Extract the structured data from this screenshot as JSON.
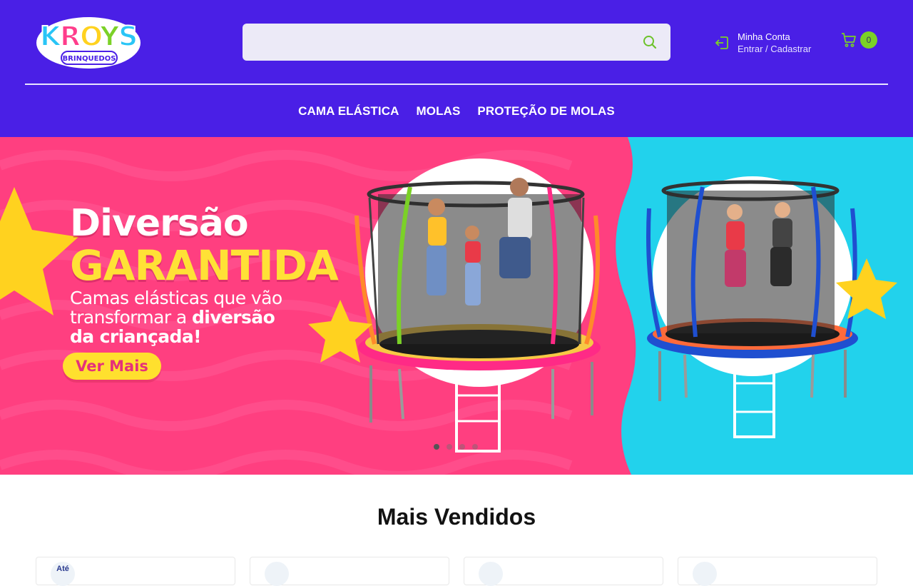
{
  "header": {
    "logo": {
      "name": "KROYS",
      "tagline": "BRINQUEDOS"
    },
    "search": {
      "placeholder": "",
      "button_icon": "search-icon"
    },
    "account": {
      "title": "Minha Conta",
      "links": "Entrar / Cadastrar",
      "icon": "login-icon"
    },
    "cart": {
      "icon": "cart-icon",
      "count": "0"
    },
    "colors": {
      "background": "#4a1fe6",
      "accent": "#7bd127"
    }
  },
  "nav": {
    "items": [
      {
        "label": "CAMA ELÁSTICA"
      },
      {
        "label": "MOLAS"
      },
      {
        "label": "PROTEÇÃO DE MOLAS"
      }
    ]
  },
  "banner": {
    "headline_line1": "Diversão",
    "headline_line2": "GARANTIDA",
    "subtitle_part1": "Camas elásticas que vão transformar a ",
    "subtitle_bold1": "diversão",
    "subtitle_bold2": "da criançada!",
    "cta_label": "Ver Mais",
    "slides": 4,
    "active_slide": 1,
    "colors": {
      "left": "#ff3f80",
      "right": "#21d3ea",
      "cta": "#ffe02e"
    }
  },
  "section": {
    "title": "Mais Vendidos",
    "cards": [
      {
        "badge": "Até"
      },
      {
        "badge": ""
      },
      {
        "badge": ""
      },
      {
        "badge": ""
      }
    ]
  }
}
